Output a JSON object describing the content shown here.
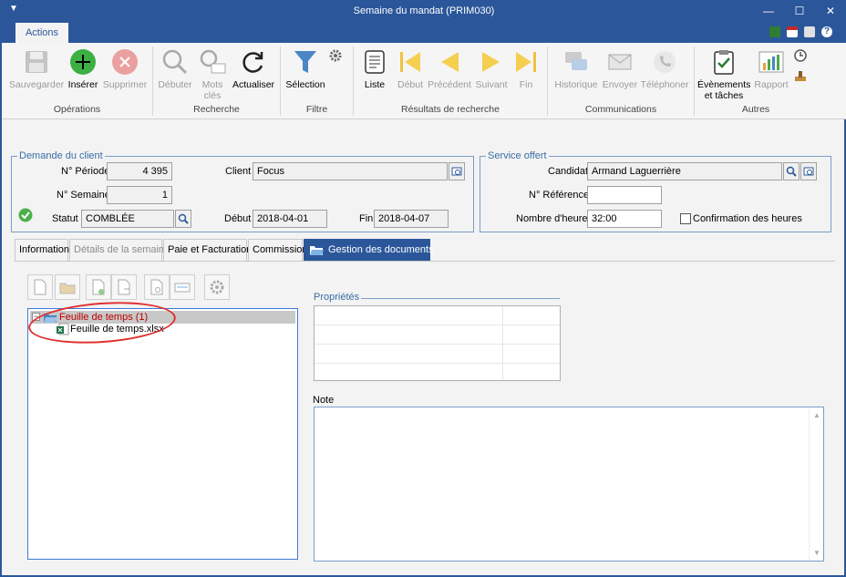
{
  "window": {
    "title": "Semaine du mandat (PRIM030)"
  },
  "ribbon": {
    "tab": "Actions",
    "groups": {
      "operations": "Opérations",
      "recherche": "Recherche",
      "filtre": "Filtre",
      "resultats": "Résultats de recherche",
      "communications": "Communications",
      "autres": "Autres"
    },
    "buttons": {
      "sauvegarder": "Sauvegarder",
      "inserer": "Insérer",
      "supprimer": "Supprimer",
      "debuter": "Débuter",
      "mots_cles_1": "Mots",
      "mots_cles_2": "clés",
      "actualiser": "Actualiser",
      "selection": "Sélection",
      "liste": "Liste",
      "debut": "Début",
      "precedent": "Précédent",
      "suivant": "Suivant",
      "fin": "Fin",
      "historique": "Historique",
      "envoyer": "Envoyer",
      "telephoner": "Téléphoner",
      "evenements_1": "Évènements",
      "evenements_2": "et tâches",
      "rapport": "Rapport"
    }
  },
  "demande": {
    "legend": "Demande du client",
    "periode_label": "N° Période",
    "periode_value": "4 395",
    "semaine_label": "N° Semaine",
    "semaine_value": "1",
    "statut_label": "Statut",
    "statut_value": "COMBLÉE",
    "client_label": "Client",
    "client_value": "Focus",
    "debut_label": "Début",
    "debut_value": "2018-04-01",
    "fin_label": "Fin",
    "fin_value": "2018-04-07"
  },
  "service": {
    "legend": "Service offert",
    "candidat_label": "Candidat",
    "candidat_value": "Armand Laguerrière",
    "reference_label": "N° Référence",
    "reference_value": "",
    "heures_label": "Nombre d'heures",
    "heures_value": "32:00",
    "confirmation_label": "Confirmation des heures"
  },
  "tabs": {
    "information": "Information",
    "details": "Détails de la semaine",
    "paie": "Paie et Facturation",
    "commission": "Commission",
    "documents": "Gestion des documents"
  },
  "documents": {
    "tree_root": "Feuille de temps (1)",
    "tree_child": "Feuille de temps.xlsx",
    "proprietes_label": "Propriétés",
    "note_label": "Note"
  },
  "colors": {
    "brand": "#2b579a",
    "insert_green": "#3cb043",
    "delete_red": "#e87a7a",
    "annotation": "#e03030"
  }
}
